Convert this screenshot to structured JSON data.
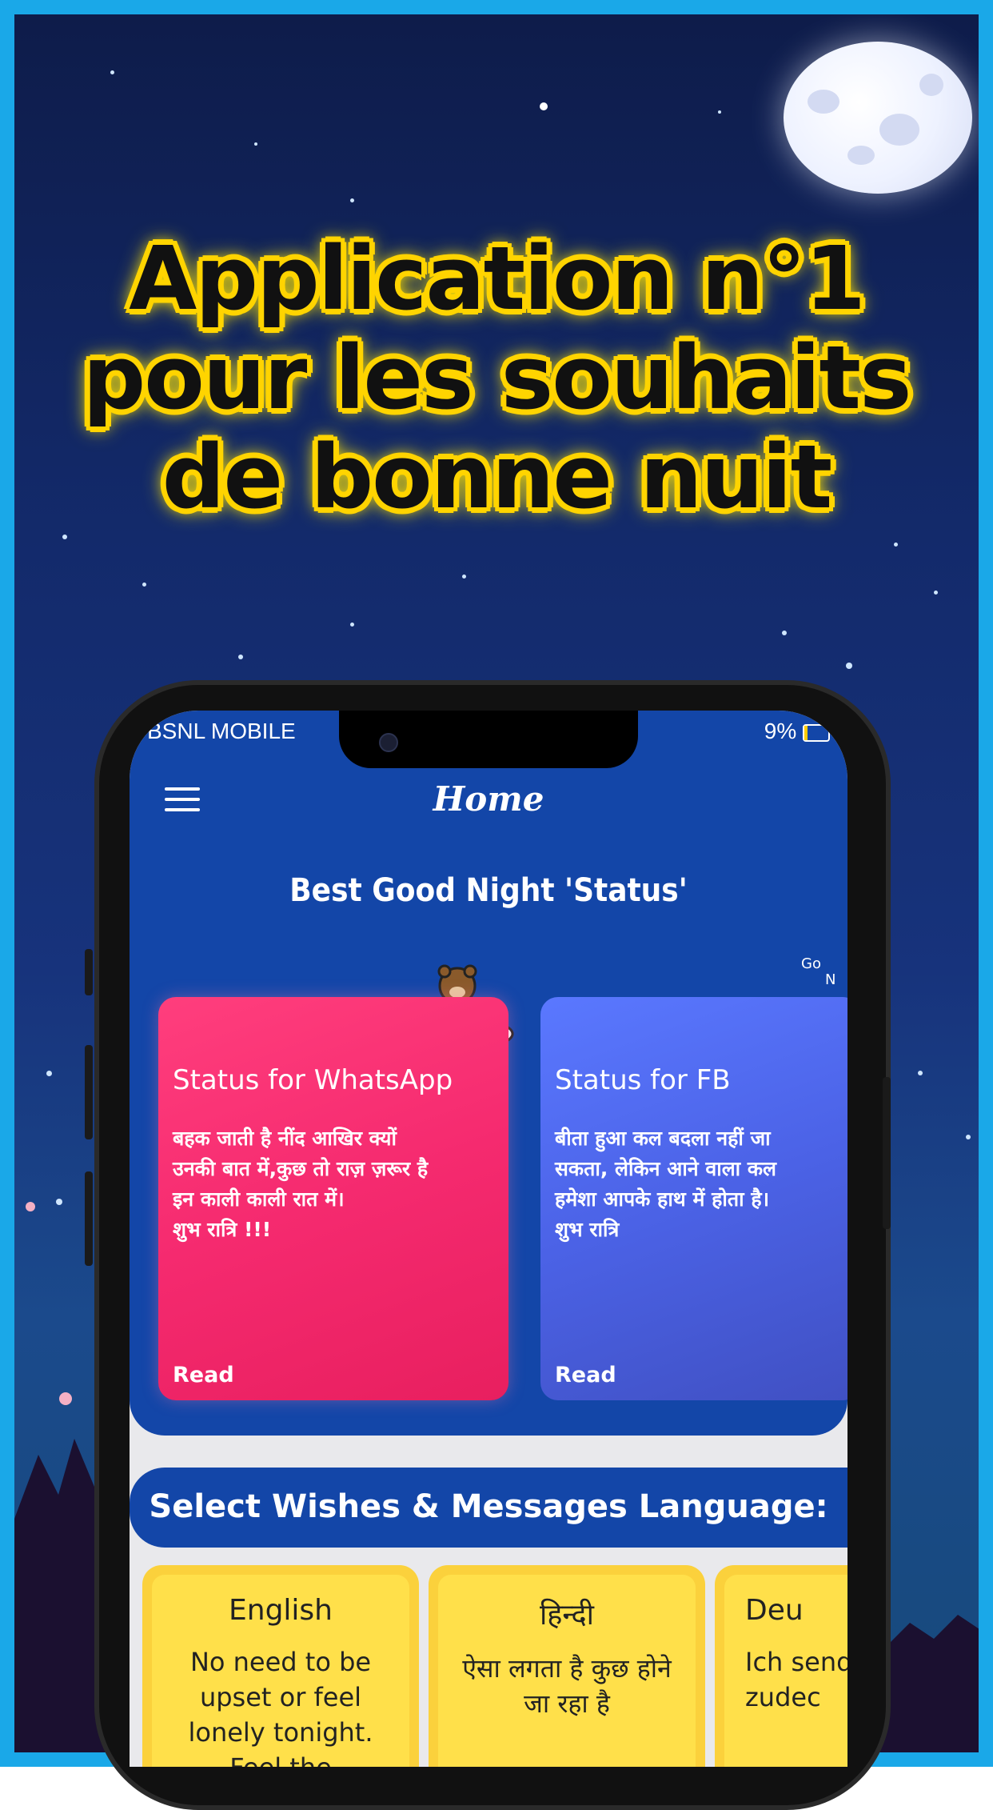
{
  "headline": {
    "line1": "Application n°1",
    "line2": "pour les souhaits",
    "line3": "de bonne nuit"
  },
  "status_bar": {
    "carrier": "BSNL MOBILE",
    "battery": "9%"
  },
  "app_bar": {
    "title": "Home"
  },
  "status_section": {
    "title": "Best Good Night 'Status'",
    "cards": [
      {
        "title": "Status for WhatsApp",
        "text": "बहक जाती है नींद आखिर क्यों\nउनकी बात में,कुछ तो राज़ ज़रूर है\nइन काली काली रात में।\nशुभ रात्रि !!!",
        "action": "Read"
      },
      {
        "title": "Status for FB",
        "text": "बीता हुआ कल बदला नहीं जा\nसकता, लेकिन आने वाला कल\nहमेशा आपके हाथ में होता है।\nशुभ रात्रि",
        "action": "Read"
      }
    ]
  },
  "language_section": {
    "title": "Select Wishes & Messages Language:",
    "languages": [
      {
        "name": "English",
        "text": "No need to be upset or feel lonely tonight. Feel the"
      },
      {
        "name": "हिन्दी",
        "text": "ऐसा लगता है कुछ होने जा रहा है"
      },
      {
        "name": "Deu",
        "text": "Ich send Wolke, zudec"
      }
    ]
  },
  "colors": {
    "border": "#1aa8e8",
    "app_blue": "#1346a8",
    "headline_glow": "#ffd400",
    "card_pink": "#f52a6f",
    "card_blue": "#4b62e6",
    "lang_yellow": "#ffe04a"
  }
}
